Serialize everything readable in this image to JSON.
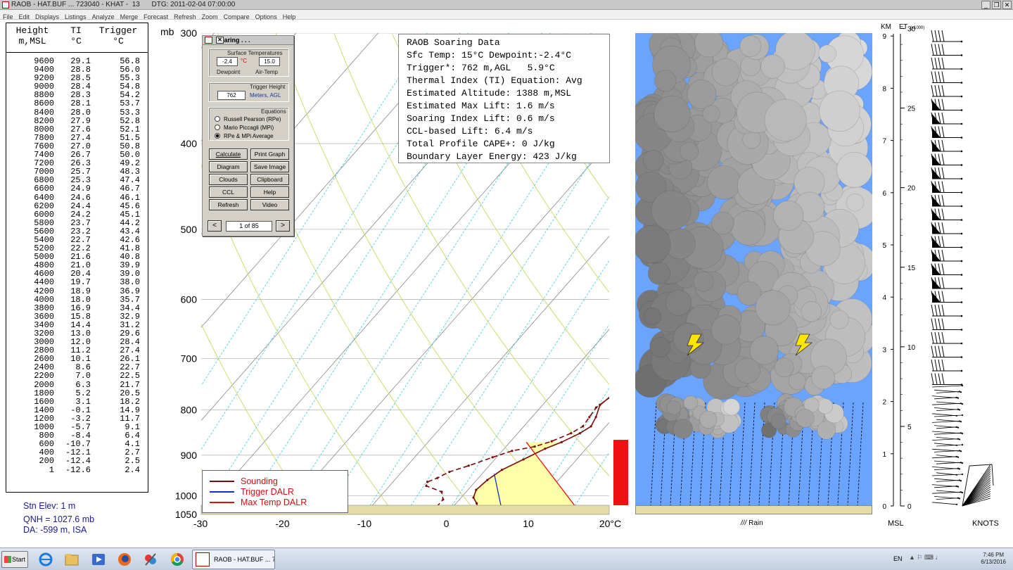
{
  "window": {
    "title": "RAOB - HAT.BUF ... 723040 - KHAT -  13      DTG: 2011-02-04 07:00:00",
    "minimize": "_",
    "restore": "❐",
    "close": "✕"
  },
  "menu": [
    "File",
    "Edit",
    "Displays",
    "Listings",
    "Analyze",
    "Merge",
    "Forecast",
    "Refresh",
    "Zoom",
    "Compare",
    "Options",
    "Help"
  ],
  "table": {
    "headers": {
      "height": "Height",
      "height_unit": "m,MSL",
      "ti": "TI",
      "ti_unit": "°C",
      "trigger": "Trigger",
      "trigger_unit": "°C"
    },
    "rows": [
      [
        "9600",
        "29.1",
        "56.8"
      ],
      [
        "9400",
        "28.8",
        "56.0"
      ],
      [
        "9200",
        "28.5",
        "55.3"
      ],
      [
        "9000",
        "28.4",
        "54.8"
      ],
      [
        "8800",
        "28.3",
        "54.2"
      ],
      [
        "8600",
        "28.1",
        "53.7"
      ],
      [
        "8400",
        "28.0",
        "53.3"
      ],
      [
        "8200",
        "27.9",
        "52.8"
      ],
      [
        "8000",
        "27.6",
        "52.1"
      ],
      [
        "7800",
        "27.4",
        "51.5"
      ],
      [
        "7600",
        "27.0",
        "50.8"
      ],
      [
        "7400",
        "26.7",
        "50.0"
      ],
      [
        "7200",
        "26.3",
        "49.2"
      ],
      [
        "7000",
        "25.7",
        "48.3"
      ],
      [
        "6800",
        "25.3",
        "47.4"
      ],
      [
        "6600",
        "24.9",
        "46.7"
      ],
      [
        "6400",
        "24.6",
        "46.1"
      ],
      [
        "6200",
        "24.4",
        "45.6"
      ],
      [
        "6000",
        "24.2",
        "45.1"
      ],
      [
        "5800",
        "23.7",
        "44.2"
      ],
      [
        "5600",
        "23.2",
        "43.4"
      ],
      [
        "5400",
        "22.7",
        "42.6"
      ],
      [
        "5200",
        "22.2",
        "41.8"
      ],
      [
        "5000",
        "21.6",
        "40.8"
      ],
      [
        "4800",
        "21.0",
        "39.9"
      ],
      [
        "4600",
        "20.4",
        "39.0"
      ],
      [
        "4400",
        "19.7",
        "38.0"
      ],
      [
        "4200",
        "18.9",
        "36.9"
      ],
      [
        "4000",
        "18.0",
        "35.7"
      ],
      [
        "3800",
        "16.9",
        "34.4"
      ],
      [
        "3600",
        "15.8",
        "32.9"
      ],
      [
        "3400",
        "14.4",
        "31.2"
      ],
      [
        "3200",
        "13.0",
        "29.6"
      ],
      [
        "3000",
        "12.0",
        "28.4"
      ],
      [
        "2800",
        "11.2",
        "27.4"
      ],
      [
        "2600",
        "10.1",
        "26.1"
      ],
      [
        "2400",
        "8.6",
        "22.7"
      ],
      [
        "2200",
        "7.0",
        "22.5"
      ],
      [
        "2000",
        "6.3",
        "21.7"
      ],
      [
        "1800",
        "5.2",
        "20.5"
      ],
      [
        "1600",
        "3.1",
        "18.2"
      ],
      [
        "1400",
        "-0.1",
        "14.9"
      ],
      [
        "1200",
        "-3.2",
        "11.7"
      ],
      [
        "1000",
        "-5.7",
        "9.1"
      ],
      [
        "800",
        "-8.4",
        "6.4"
      ],
      [
        "600",
        "-10.7",
        "4.1"
      ],
      [
        "400",
        "-12.1",
        "2.7"
      ],
      [
        "200",
        "-12.4",
        "2.5"
      ],
      [
        "1",
        "-12.6",
        "2.4"
      ]
    ]
  },
  "station": {
    "elev": "Stn Elev: 1 m",
    "qnh": "QNH = 1027.6 mb",
    "da": "DA: -599 m, ISA"
  },
  "skewt": {
    "p_unit": "mb",
    "pressure_labels": [
      {
        "p": 300,
        "label": "300"
      },
      {
        "p": 400,
        "label": "400"
      },
      {
        "p": 500,
        "label": "500"
      },
      {
        "p": 600,
        "label": "600"
      },
      {
        "p": 700,
        "label": "700"
      },
      {
        "p": 800,
        "label": "800"
      },
      {
        "p": 900,
        "label": "900"
      },
      {
        "p": 1000,
        "label": "1000"
      },
      {
        "p": 1050,
        "label": "1050"
      }
    ],
    "temp_labels": [
      {
        "t": -30,
        "label": "-30"
      },
      {
        "t": -20,
        "label": "-20"
      },
      {
        "t": -10,
        "label": "-10"
      },
      {
        "t": 0,
        "label": "0"
      },
      {
        "t": 10,
        "label": "10"
      },
      {
        "t": 20,
        "label": "20°C"
      }
    ],
    "temperature_profile": [
      [
        1030,
        3.0
      ],
      [
        1020,
        2.5
      ],
      [
        1005,
        1.5
      ],
      [
        985,
        1.0
      ],
      [
        960,
        1.3
      ],
      [
        935,
        2.0
      ],
      [
        910,
        3.5
      ],
      [
        885,
        5.0
      ],
      [
        870,
        6.3
      ],
      [
        850,
        7.6
      ],
      [
        835,
        8.2
      ],
      [
        815,
        7.8
      ],
      [
        790,
        7.0
      ],
      [
        760,
        7.6
      ],
      [
        740,
        7.8
      ],
      [
        720,
        7.3
      ],
      [
        700,
        7.0
      ],
      [
        670,
        7.3
      ],
      [
        650,
        7.5
      ],
      [
        630,
        7.0
      ],
      [
        610,
        6.4
      ],
      [
        585,
        5.5
      ],
      [
        560,
        4.7
      ],
      [
        530,
        3.6
      ],
      [
        505,
        3.0
      ],
      [
        480,
        2.3
      ],
      [
        455,
        0.8
      ],
      [
        430,
        -2.0
      ],
      [
        410,
        -4.5
      ],
      [
        395,
        -6.0
      ],
      [
        380,
        -7.5
      ],
      [
        360,
        -8.5
      ],
      [
        340,
        -10.5
      ],
      [
        320,
        -12.5
      ],
      [
        300,
        -14.5
      ]
    ],
    "dewpoint_profile": [
      [
        1030,
        -2.0
      ],
      [
        1010,
        -2.0
      ],
      [
        990,
        -3.0
      ],
      [
        975,
        -5.5
      ],
      [
        965,
        -5.8
      ],
      [
        955,
        -5.0
      ],
      [
        940,
        -4.2
      ],
      [
        925,
        -2.5
      ],
      [
        905,
        -0.5
      ],
      [
        890,
        1.2
      ],
      [
        880,
        3.5
      ],
      [
        868,
        5.0
      ],
      [
        850,
        6.5
      ],
      [
        835,
        7.2
      ],
      [
        815,
        7.0
      ],
      [
        795,
        6.8
      ],
      [
        770,
        7.5
      ],
      [
        740,
        7.6
      ],
      [
        720,
        7.2
      ],
      [
        700,
        7.0
      ],
      [
        670,
        7.0
      ],
      [
        640,
        7.2
      ],
      [
        615,
        6.8
      ],
      [
        590,
        5.8
      ],
      [
        565,
        5.0
      ],
      [
        540,
        4.0
      ],
      [
        515,
        3.2
      ],
      [
        490,
        2.5
      ],
      [
        470,
        0.5
      ],
      [
        445,
        -2.5
      ],
      [
        425,
        -4.0
      ],
      [
        405,
        -6.0
      ],
      [
        385,
        -7.5
      ],
      [
        365,
        -8.5
      ],
      [
        345,
        -9.5
      ],
      [
        325,
        -10.8
      ],
      [
        300,
        -13.0
      ]
    ],
    "trigger_dalr": [
      [
        1030,
        5.9
      ],
      [
        945,
        1.5
      ]
    ],
    "max_temp_dalr": [
      [
        1030,
        15.0
      ],
      [
        870,
        2.0
      ]
    ]
  },
  "info": {
    "title": "RAOB Soaring Data",
    "lines": [
      "Sfc Temp: 15°C Dewpoint:-2.4°C",
      "Trigger*: 762 m,AGL   5.9°C",
      "Thermal Index (TI) Equation: Avg",
      "Estimated Altitude: 1388 m,MSL",
      "Estimated Max Lift: 1.6 m/s",
      "Soaring Index Lift: 0.6 m/s",
      "CCL-based Lift: 6.4 m/s",
      "Total Profile CAPE+: 0 J/kg",
      "Boundary Layer Energy: 423 J/kg"
    ]
  },
  "dialog": {
    "title": "Soaring . . .",
    "close": "✕",
    "surface_label": "Surface Temperatures",
    "dewpoint_value": "-2.4",
    "unit": "°C",
    "airtemp_value": "15.0",
    "dewpoint_caption": "Dewpoint",
    "airtemp_caption": "Air-Temp",
    "trigger_label": "Trigger Height",
    "trigger_value": "762",
    "trigger_unit": "Meters, AGL",
    "equations_label": "Equations",
    "eq1": "Russell Pearson (RPe)",
    "eq2": "Mario Piccagli (MPi)",
    "eq3": "RPe & MPi Average",
    "buttons": [
      "Calculate",
      "Print Graph",
      "Diagram",
      "Save Image",
      "Clouds",
      "Clipboard",
      "CCL",
      "Help",
      "Refresh",
      "Video"
    ],
    "prev": "<",
    "next": ">",
    "page": "1 of 85"
  },
  "legend": {
    "sounding": "Sounding",
    "trigger": "Trigger DALR",
    "maxtemp": "Max Temp DALR"
  },
  "colors": {
    "sounding": "#7a0a0a",
    "trigger": "#1030c0",
    "maxtemp": "#e01010",
    "parcel_fill": "#ffffa8",
    "sky": "#6aa4ff"
  },
  "cloud": {
    "rain_label": "Rain"
  },
  "wind": {
    "km_label": "KM",
    "ft_label": "FT",
    "ft_mult": "(x1000)",
    "msl_label": "MSL",
    "knots_label": "KNOTS",
    "km_ticks": [
      {
        "v": 0,
        "l": "0"
      },
      {
        "v": 1,
        "l": "1"
      },
      {
        "v": 2,
        "l": "2"
      },
      {
        "v": 3,
        "l": "3"
      },
      {
        "v": 4,
        "l": "4"
      },
      {
        "v": 5,
        "l": "5"
      },
      {
        "v": 6,
        "l": "6"
      },
      {
        "v": 7,
        "l": "7"
      },
      {
        "v": 8,
        "l": "8"
      },
      {
        "v": 9,
        "l": "9"
      }
    ],
    "ft_ticks": [
      {
        "v": 0,
        "l": "0"
      },
      {
        "v": 5,
        "l": "5"
      },
      {
        "v": 10,
        "l": "10"
      },
      {
        "v": 15,
        "l": "15"
      },
      {
        "v": 20,
        "l": "20"
      },
      {
        "v": 25,
        "l": "25"
      },
      {
        "v": 30,
        "l": "30"
      }
    ]
  },
  "taskbar": {
    "start": "Start",
    "task": "RAOB - HAT.BUF ... 723...",
    "lang": "EN",
    "time": "7:46 PM",
    "date": "6/13/2016"
  }
}
